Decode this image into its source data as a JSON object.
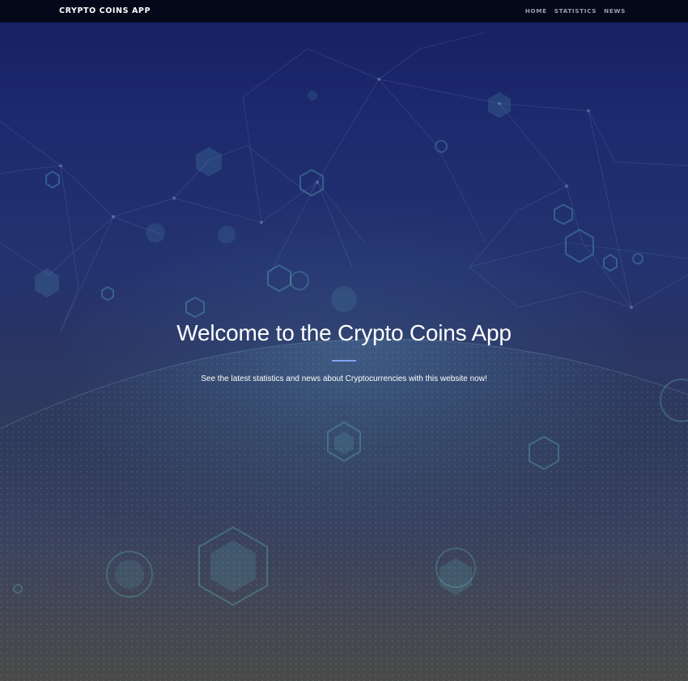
{
  "navbar": {
    "brand": "CRYPTO COINS APP",
    "links": [
      {
        "label": "HOME"
      },
      {
        "label": "STATISTICS"
      },
      {
        "label": "NEWS"
      }
    ]
  },
  "hero": {
    "title": "Welcome to the Crypto Coins App",
    "subtitle": "See the latest statistics and news about Cryptocurrencies with this website now!"
  },
  "colors": {
    "navbar_bg": "#050818",
    "hero_top": "#161f62",
    "hero_bottom": "#4a4a48",
    "accent_divider": "#7ea6f0",
    "hex_accent": "#5fb8c0"
  }
}
